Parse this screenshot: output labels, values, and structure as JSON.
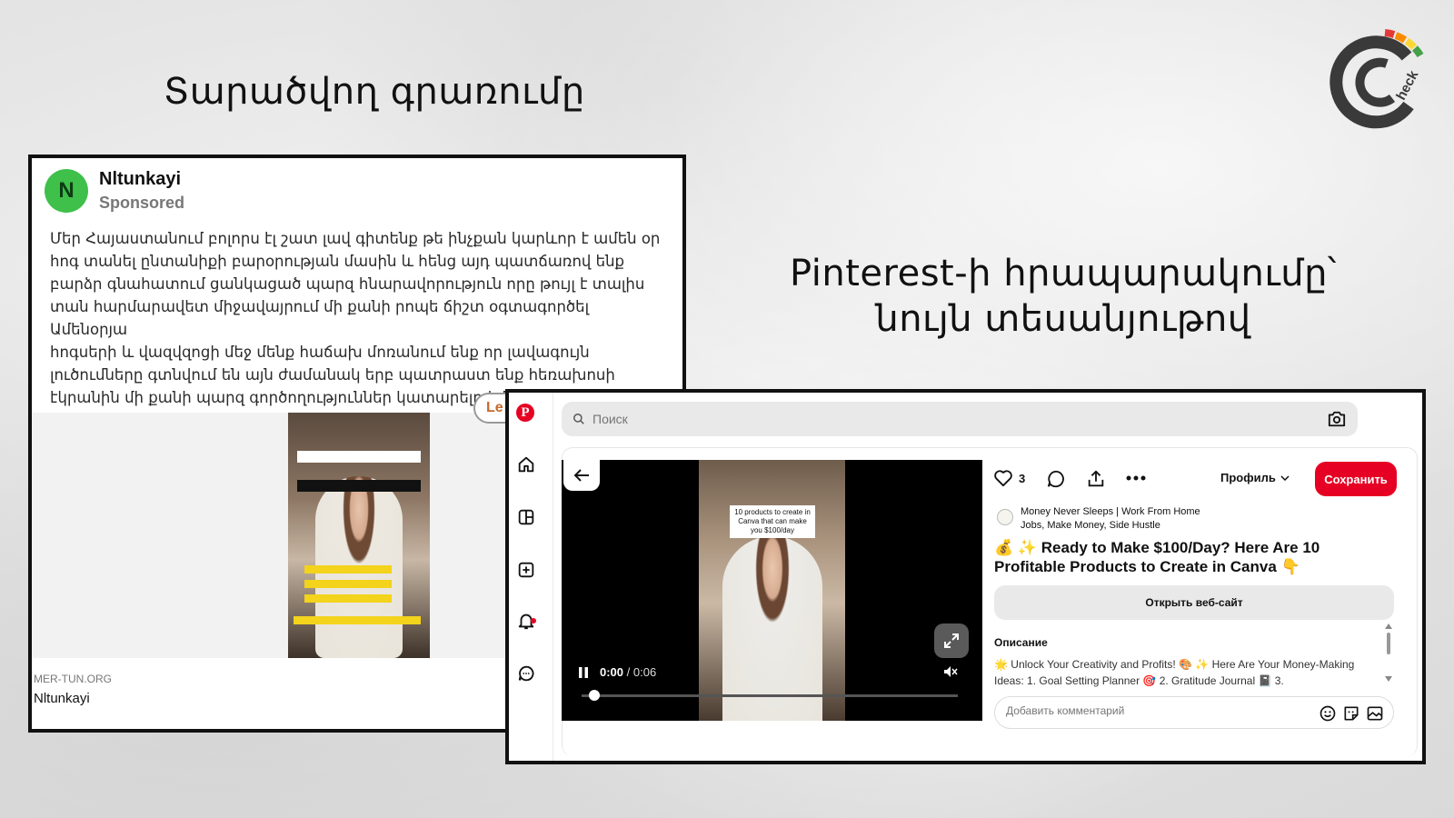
{
  "headings": {
    "left": "Տարածվող գրառումը",
    "right_line1": "Pinterest-ի հրապարակումը՝",
    "right_line2": "նույն տեսանյութով"
  },
  "facebook_ad": {
    "avatar_letter": "N",
    "page_name": "Nltunkayi",
    "sponsored": "Sponsored",
    "body_lines": [
      "Մեր Հայաստանում բոլորս էլ շատ լավ գիտենք թե ինչքան կարևոր է ամեն օր",
      "հոգ տանել ընտանիքի բարօրության մասին և հենց այդ պատճառով ենք",
      "բարձր գնահատում ցանկացած պարզ հնարավորություն որը թույլ է տալիս",
      "տան հարմարավետ միջավայրում մի քանի րոպե ճիշտ օգտագործել Ամենօրյա",
      "հոգսերի և վազվզոցի մեջ մենք հաճախ մոռանում ենք որ լավագույն",
      "լուծումները գտնվում են այն ժամանակ երբ պատրաստ ենք հեռախոսի",
      "էկրանին մի քանի պարզ գործողություններ կատարելով միանալ ընդհանուր ..."
    ],
    "cta_peek": "Le",
    "domain": "MER-TUN.ORG",
    "footer_name": "Nltunkayi"
  },
  "pinterest": {
    "search_placeholder": "Поиск",
    "video": {
      "caption": "10 products to create in Canva that can make you $100/day",
      "time_current": "0:00",
      "time_sep": " / ",
      "time_total": "0:06",
      "progress_fraction": 0.02
    },
    "like_count": "3",
    "profile_label": "Профиль",
    "save_label": "Сохранить",
    "author_line1": "Money Never Sleeps | Work From Home",
    "author_line2": "Jobs, Make Money, Side Hustle",
    "title": "💰 ✨ Ready to Make $100/Day? Here Are 10 Profitable Products to Create in Canva 👇",
    "open_site_label": "Открыть веб-сайт",
    "description_label": "Описание",
    "description_text": "🌟 Unlock Your Creativity and Profits! 🎨 ✨ Here Are Your Money-Making Ideas: 1. Goal Setting Planner 🎯 2. Gratitude Journal 📓 3.",
    "comment_placeholder": "Добавить комментарий"
  },
  "colors": {
    "pinterest_red": "#e60023",
    "fb_avatar_green": "#3ec04a"
  }
}
